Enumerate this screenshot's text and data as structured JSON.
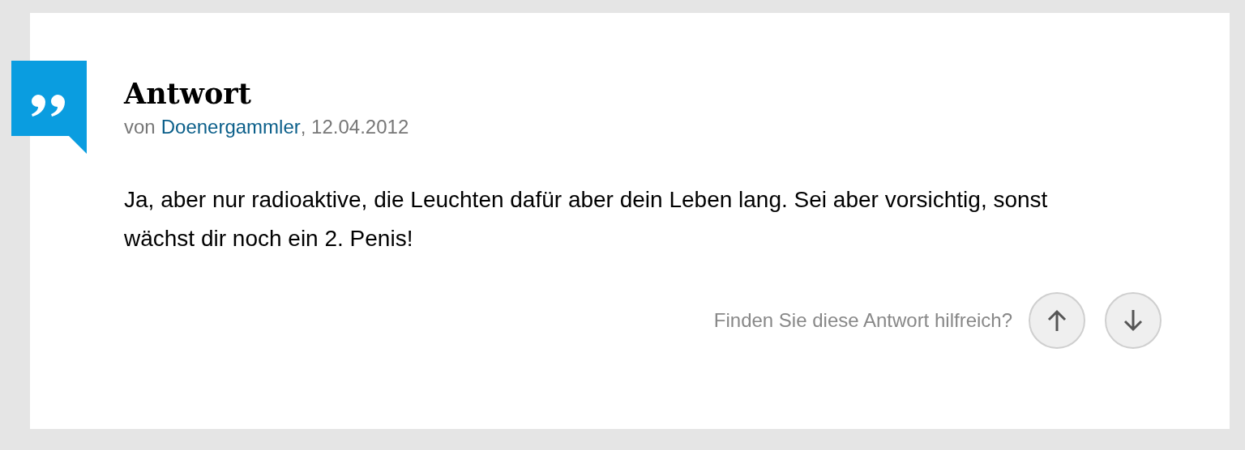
{
  "answer": {
    "title": "Antwort",
    "byline_prefix": "von",
    "author": "Doenergammler",
    "date": ", 12.04.2012",
    "body": "Ja, aber nur radioaktive, die Leuchten dafür aber dein Leben lang. Sei aber vorsichtig, sonst wächst dir noch ein 2. Penis!",
    "helpful_prompt": "Finden Sie diese Antwort hilfreich?"
  }
}
